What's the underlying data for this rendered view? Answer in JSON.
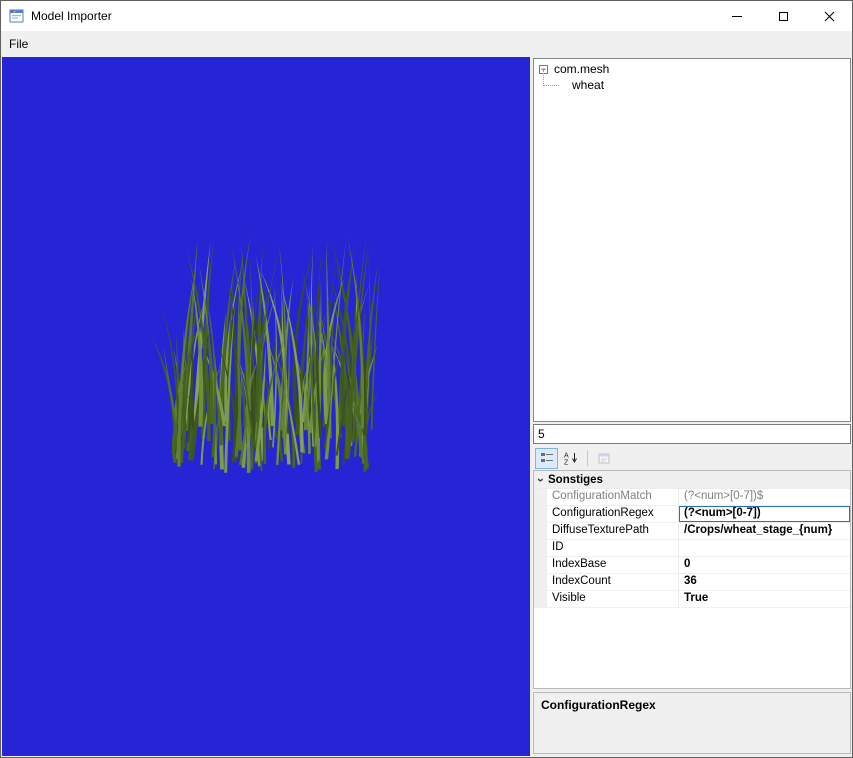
{
  "window": {
    "title": "Model Importer"
  },
  "icons": {
    "app_icon": "form-icon",
    "minimize_icon": "minimize",
    "maximize_icon": "maximize",
    "close_icon": "close",
    "categorized_icon": "categorized-view",
    "alphabetical_icon": "alphabetical-sort",
    "property_pages_icon": "property-pages",
    "expand_glyph": "−",
    "chevron_glyph": "›"
  },
  "menubar": {
    "file": "File"
  },
  "tree": {
    "root_label": "com.mesh",
    "child_label": "wheat"
  },
  "value_box": {
    "value": "5"
  },
  "grid": {
    "category": "Sonstiges",
    "rows": [
      {
        "name": "ConfigurationMatch",
        "value": "(?<num>[0-7])$",
        "readonly": true
      },
      {
        "name": "ConfigurationRegex",
        "value": "(?<num>[0-7])",
        "bold": true,
        "selected": true
      },
      {
        "name": "DiffuseTexturePath",
        "value": "/Crops/wheat_stage_{num}",
        "bold": true
      },
      {
        "name": "ID",
        "value": ""
      },
      {
        "name": "IndexBase",
        "value": "0",
        "bold": true
      },
      {
        "name": "IndexCount",
        "value": "36",
        "bold": true
      },
      {
        "name": "Visible",
        "value": "True",
        "bold": true
      }
    ],
    "help_title": "ConfigurationRegex"
  },
  "colors": {
    "viewport": "#2525d6",
    "accent": "#0078d7",
    "selection_border": "#2a6dbd",
    "grass": [
      "#3c571f",
      "#49671f",
      "#55762c",
      "#627f33",
      "#6e8f3d",
      "#7d9c49",
      "#475f24",
      "#394e1c",
      "#86a054",
      "#41601e"
    ]
  }
}
